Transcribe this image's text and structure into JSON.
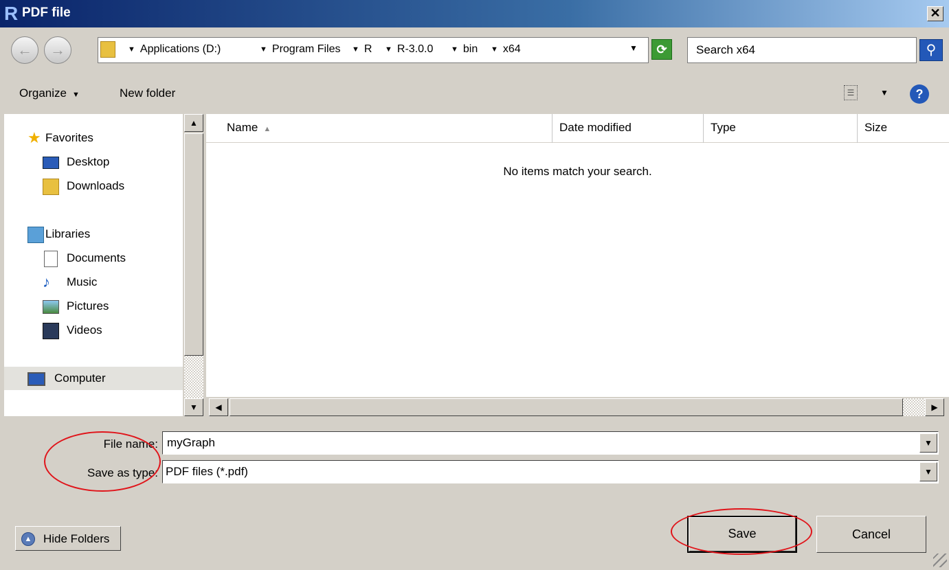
{
  "window": {
    "title": "PDF file",
    "app_icon": "R"
  },
  "address": {
    "breadcrumbs": [
      "Applications (D:)",
      "Program Files",
      "R",
      "R-3.0.0",
      "bin",
      "x64"
    ]
  },
  "search": {
    "value": "Search x64"
  },
  "toolbar": {
    "organize_label": "Organize",
    "new_folder_label": "New folder"
  },
  "nav": {
    "favorites": {
      "label": "Favorites",
      "items": [
        "Desktop",
        "Downloads"
      ]
    },
    "libraries": {
      "label": "Libraries",
      "items": [
        "Documents",
        "Music",
        "Pictures",
        "Videos"
      ]
    },
    "computer": {
      "label": "Computer"
    }
  },
  "list": {
    "columns": [
      "Name",
      "Date modified",
      "Type",
      "Size"
    ],
    "empty_message": "No items match your search."
  },
  "form": {
    "file_name_label": "File name:",
    "file_name_value": "myGraph",
    "save_type_label": "Save as type:",
    "save_type_value": "PDF files (*.pdf)"
  },
  "buttons": {
    "hide_folders": "Hide Folders",
    "save": "Save",
    "cancel": "Cancel"
  },
  "colors": {
    "annotation": "#e0141a",
    "titlebar": "#0a246a",
    "dialog_bg": "#d4d0c8"
  }
}
